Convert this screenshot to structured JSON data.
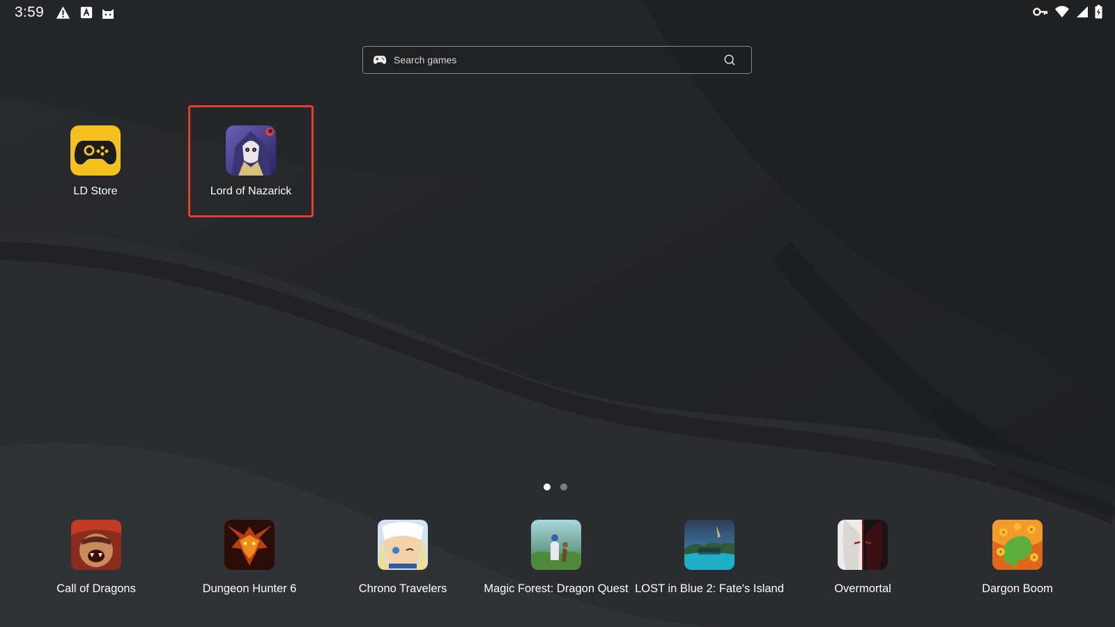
{
  "status_bar": {
    "time": "3:59",
    "left_icons": [
      "warning-icon",
      "a-box-icon",
      "cat-icon"
    ],
    "right_icons": [
      "key-icon",
      "wifi-icon",
      "signal-icon",
      "battery-icon"
    ]
  },
  "search": {
    "placeholder": "Search games",
    "value": ""
  },
  "desktop_apps": [
    {
      "label": "LD Store",
      "icon": "ld-store-icon"
    },
    {
      "label": "Lord of Nazarick",
      "icon": "lord-of-nazarick-icon",
      "selected": true
    }
  ],
  "page_indicator": {
    "pages": 2,
    "current": 1
  },
  "dock_apps": [
    {
      "label": "Call of Dragons"
    },
    {
      "label": "Dungeon Hunter 6"
    },
    {
      "label": "Chrono Travelers"
    },
    {
      "label": "Magic Forest: Dragon Quest"
    },
    {
      "label": "LOST in Blue 2: Fate's Island"
    },
    {
      "label": "Overmortal"
    },
    {
      "label": "Dargon Boom"
    }
  ],
  "colors": {
    "selection": "#e2402b",
    "ld_store": "#f5c11e",
    "background": "#232427"
  }
}
